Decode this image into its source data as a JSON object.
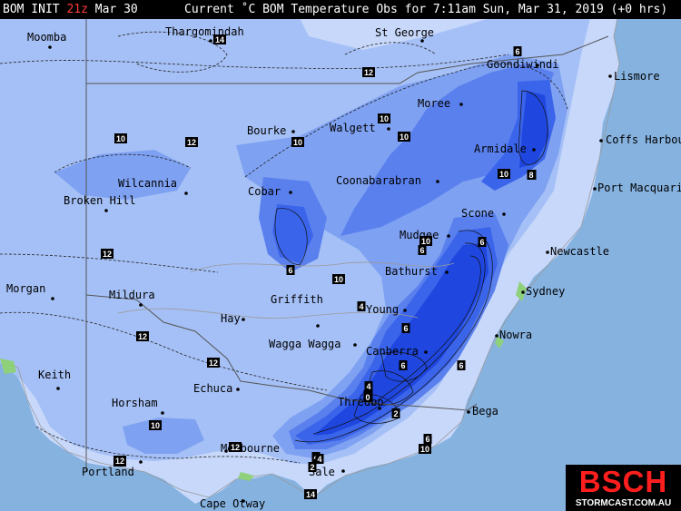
{
  "header": {
    "model": "BOM INIT",
    "init_time": "21z",
    "init_date": "Mar 30",
    "title": "Current ˚C BOM Temperature Obs for 7:11am Sun, Mar 31, 2019 (+0 hrs)"
  },
  "colors": {
    "ocean": "#86b2e0",
    "warm": "#c7d8fb",
    "mid": "#a5c0f6",
    "cool": "#7ea1f2",
    "colder": "#5a80ee",
    "cold": "#3a64ea",
    "coldest": "#1f47e0"
  },
  "cities": [
    {
      "name": "Moomba"
    },
    {
      "name": "Thargomindah"
    },
    {
      "name": "St George"
    },
    {
      "name": "Goondiwindi"
    },
    {
      "name": "Lismore"
    },
    {
      "name": "Moree"
    },
    {
      "name": "Bourke"
    },
    {
      "name": "Walgett"
    },
    {
      "name": "Coffs Harbour"
    },
    {
      "name": "Armidale"
    },
    {
      "name": "Wilcannia"
    },
    {
      "name": "Broken Hill"
    },
    {
      "name": "Cobar"
    },
    {
      "name": "Coonabarabran"
    },
    {
      "name": "Port Macquarie"
    },
    {
      "name": "Scone"
    },
    {
      "name": "Mudgee"
    },
    {
      "name": "Newcastle"
    },
    {
      "name": "Bathurst"
    },
    {
      "name": "Sydney"
    },
    {
      "name": "Morgan"
    },
    {
      "name": "Mildura"
    },
    {
      "name": "Griffith"
    },
    {
      "name": "Hay"
    },
    {
      "name": "Young"
    },
    {
      "name": "Nowra"
    },
    {
      "name": "Wagga Wagga"
    },
    {
      "name": "Canberra"
    },
    {
      "name": "Keith"
    },
    {
      "name": "Echuca"
    },
    {
      "name": "Horsham"
    },
    {
      "name": "Thredbo"
    },
    {
      "name": "Bega"
    },
    {
      "name": "Melbourne"
    },
    {
      "name": "Portland"
    },
    {
      "name": "Sale"
    },
    {
      "name": "Cape Otway"
    }
  ],
  "contour_labels": [
    "14",
    "12",
    "6",
    "12",
    "10",
    "12",
    "10",
    "10",
    "10",
    "8",
    "10",
    "12",
    "6",
    "6",
    "10",
    "10",
    "6",
    "4",
    "6",
    "4",
    "12",
    "12",
    "12",
    "6",
    "10",
    "10",
    "4",
    "6",
    "2",
    "2",
    "4",
    "2",
    "0",
    "4",
    "6",
    "12",
    "12",
    "8",
    "14"
  ],
  "logo": {
    "main": "BSCH",
    "sub": "STORMCAST.COM.AU"
  }
}
